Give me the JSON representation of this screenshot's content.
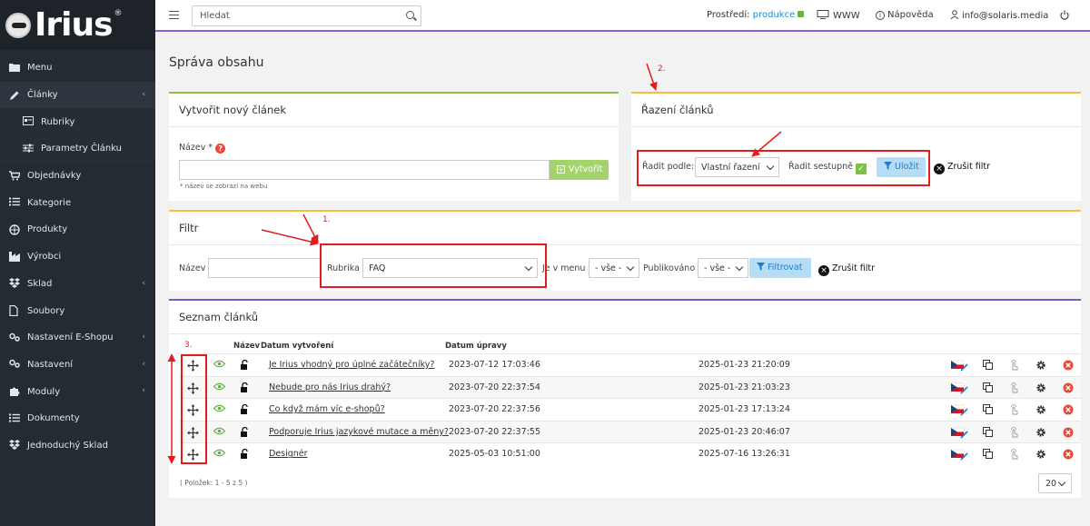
{
  "sidebar": {
    "brand": "Irius",
    "reg": "®",
    "items": [
      {
        "label": "Menu",
        "icon": "folder-icon"
      },
      {
        "label": "Články",
        "icon": "pencil-icon",
        "active": true,
        "arrow": "‹"
      },
      {
        "label": "Rubriky",
        "icon": "category-icon",
        "sub": true
      },
      {
        "label": "Parametry Článku",
        "icon": "sliders-icon",
        "sub": true
      },
      {
        "label": "Objednávky",
        "icon": "cart-icon"
      },
      {
        "label": "Kategorie",
        "icon": "list-icon"
      },
      {
        "label": "Produkty",
        "icon": "basket-icon"
      },
      {
        "label": "Výrobci",
        "icon": "factory-icon"
      },
      {
        "label": "Sklad",
        "icon": "dropbox-icon",
        "arrow": "‹"
      },
      {
        "label": "Soubory",
        "icon": "file-icon"
      },
      {
        "label": "Nastavení E-Shopu",
        "icon": "cog-pair-icon",
        "arrow": "‹"
      },
      {
        "label": "Nastavení",
        "icon": "cog-pair-icon",
        "arrow": "‹"
      },
      {
        "label": "Moduly",
        "icon": "puzzle-icon",
        "arrow": "‹"
      },
      {
        "label": "Dokumenty",
        "icon": "list-icon"
      },
      {
        "label": "Jednoduchý Sklad",
        "icon": "dropbox-icon"
      }
    ]
  },
  "topbar": {
    "search_placeholder": "Hledat",
    "env_label": "Prostředí:",
    "env_value": "produkce",
    "www": "WWW",
    "help": "Nápověda",
    "user": "info@solaris.media"
  },
  "page": {
    "title": "Správa obsahu"
  },
  "create": {
    "title": "Vytvořit nový článek",
    "name_label": "Název *",
    "help": "?",
    "button": "Vytvořit",
    "note": "* název se zobrazí na webu"
  },
  "sort": {
    "title": "Řazení článků",
    "sort_by_label": "Řadit podle:",
    "sort_by_value": "Vlastní řazení",
    "desc_label": "Řadit sestupně",
    "checkmark": "✓",
    "save_button": "Uložit",
    "cancel_filter": "Zrušit filtr"
  },
  "filter": {
    "title": "Filtr",
    "name_label": "Název",
    "rubric_label": "Rubrika",
    "rubric_value": "FAQ",
    "in_menu_label": "Je v menu",
    "in_menu_value": "- vše -",
    "published_label": "Publikováno",
    "published_value": "- vše -",
    "filter_button": "Filtrovat",
    "cancel_filter": "Zrušit filtr"
  },
  "list": {
    "title": "Seznam článků",
    "columns": {
      "name": "Název",
      "created": "Datum vytvoření",
      "modified": "Datum úpravy"
    },
    "rows": [
      {
        "name": "Je Irius vhodný pro úplné začátečníky?",
        "created": "2023-07-12 17:03:46",
        "modified": "2025-01-23 21:20:09"
      },
      {
        "name": "Nebude pro nás Irius drahý?",
        "created": "2023-07-20 22:37:54",
        "modified": "2025-01-23 21:03:23"
      },
      {
        "name": "Co když mám víc e-shopů?",
        "created": "2023-07-20 22:37:56",
        "modified": "2025-01-23 17:13:24"
      },
      {
        "name": "Podporuje Irius jazykové mutace a měny?",
        "created": "2023-07-20 22:37:55",
        "modified": "2025-01-23 20:46:07"
      },
      {
        "name": "Designér",
        "created": "2025-05-03 10:51:00",
        "modified": "2025-07-16 13:26:31"
      }
    ],
    "pager_info": "( Položek: 1 - 5 z 5 )",
    "per_page": "20"
  },
  "annotations": {
    "one": "1.",
    "two": "2.",
    "three": "3."
  },
  "colors": {
    "sidebar": "#252b33",
    "accent_purple": "#9b59d0",
    "annotation_red": "#e31d1d",
    "link_blue": "#1c8fd6"
  }
}
